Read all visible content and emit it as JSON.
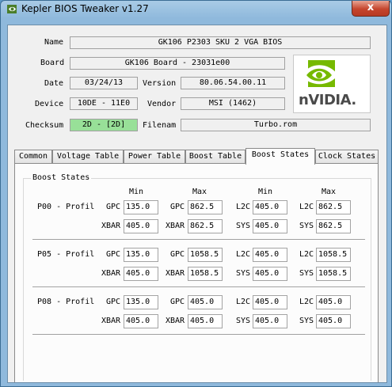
{
  "window": {
    "title": "Kepler BIOS Tweaker v1.27",
    "close_glyph": "x"
  },
  "header": {
    "name_label": "Name",
    "name_value": "GK106 P2303 SKU 2 VGA BIOS",
    "board_label": "Board",
    "board_value": "GK106 Board - 23031e00",
    "date_label": "Date",
    "date_value": "03/24/13",
    "version_label": "Version",
    "version_value": "80.06.54.00.11",
    "device_label": "Device",
    "device_value": "10DE - 11E0",
    "vendor_label": "Vendor",
    "vendor_value": "MSI (1462)",
    "checksum_label": "Checksum",
    "checksum_value": "2D - [2D]",
    "filename_label": "Filenam",
    "filename_value": "Turbo.rom",
    "logo_text": "nVIDIA."
  },
  "tabs": [
    "Common",
    "Voltage Table",
    "Power Table",
    "Boost Table",
    "Boost States",
    "Clock States"
  ],
  "active_tab": "Boost States",
  "boost": {
    "group_title": "Boost States",
    "col_headers": [
      "Min",
      "Max",
      "Min",
      "Max"
    ],
    "rows": [
      {
        "label": "P00 - Profil",
        "r1": {
          "la": "GPC",
          "va": "135.0",
          "lb": "GPC",
          "vb": "862.5",
          "lc": "L2C",
          "vc": "405.0",
          "ld": "L2C",
          "vd": "862.5"
        },
        "r2": {
          "la": "XBAR",
          "va": "405.0",
          "lb": "XBAR",
          "vb": "862.5",
          "lc": "SYS",
          "vc": "405.0",
          "ld": "SYS",
          "vd": "862.5"
        }
      },
      {
        "label": "P05 - Profil",
        "r1": {
          "la": "GPC",
          "va": "135.0",
          "lb": "GPC",
          "vb": "1058.5",
          "lc": "L2C",
          "vc": "405.0",
          "ld": "L2C",
          "vd": "1058.5"
        },
        "r2": {
          "la": "XBAR",
          "va": "405.0",
          "lb": "XBAR",
          "vb": "1058.5",
          "lc": "SYS",
          "vc": "405.0",
          "ld": "SYS",
          "vd": "1058.5"
        }
      },
      {
        "label": "P08 - Profil",
        "r1": {
          "la": "GPC",
          "va": "135.0",
          "lb": "GPC",
          "vb": "405.0",
          "lc": "L2C",
          "vc": "405.0",
          "ld": "L2C",
          "vd": "405.0"
        },
        "r2": {
          "la": "XBAR",
          "va": "405.0",
          "lb": "XBAR",
          "vb": "405.0",
          "lc": "SYS",
          "vc": "405.0",
          "ld": "SYS",
          "vd": "405.0"
        }
      }
    ]
  },
  "colors": {
    "checksum_ok": "#98e098",
    "nvidia_green": "#76b900"
  }
}
